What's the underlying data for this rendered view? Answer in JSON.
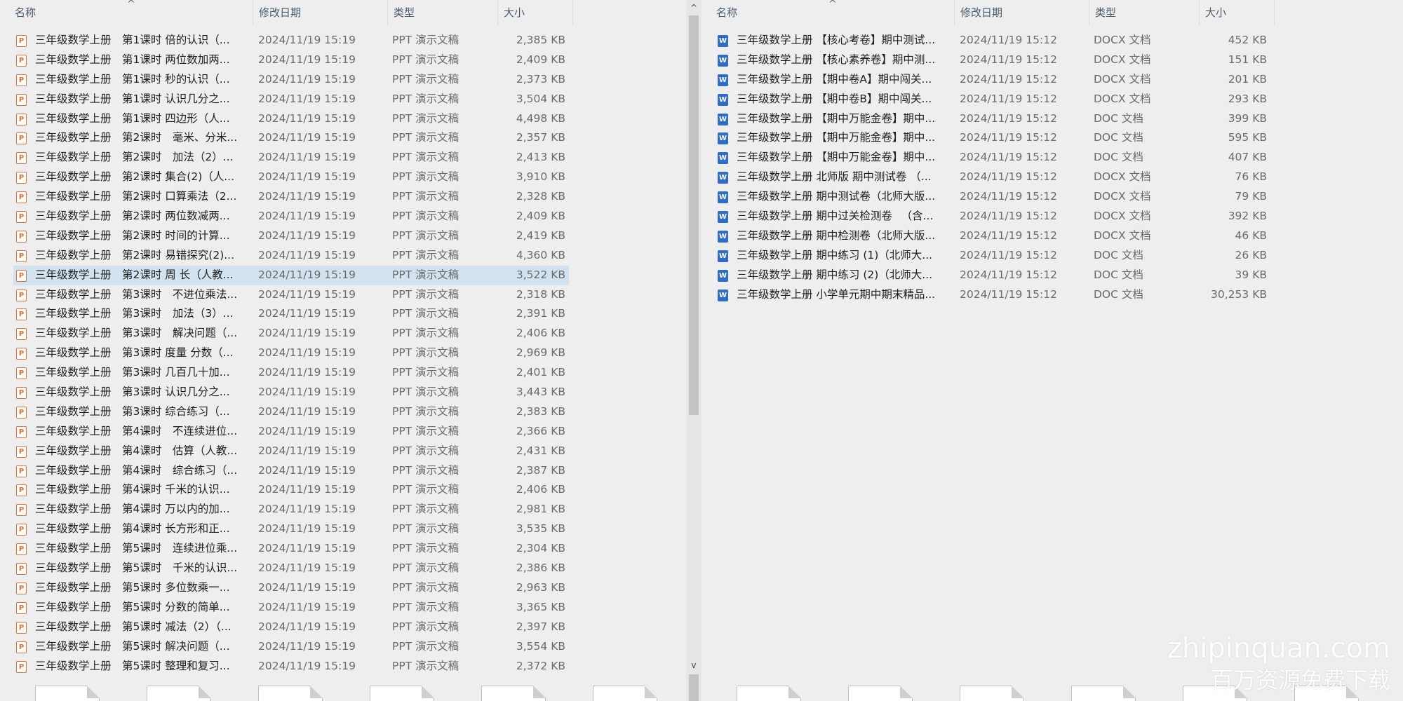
{
  "columns": {
    "name": "名称",
    "date": "修改日期",
    "type": "类型",
    "size": "大小"
  },
  "left_rows": [
    {
      "name": "三年级数学上册　第1课时 倍的认识（...",
      "date": "2024/11/19 15:19",
      "type": "PPT 演示文稿",
      "size": "2,385 KB"
    },
    {
      "name": "三年级数学上册　第1课时 两位数加两...",
      "date": "2024/11/19 15:19",
      "type": "PPT 演示文稿",
      "size": "2,409 KB"
    },
    {
      "name": "三年级数学上册　第1课时 秒的认识（...",
      "date": "2024/11/19 15:19",
      "type": "PPT 演示文稿",
      "size": "2,373 KB"
    },
    {
      "name": "三年级数学上册　第1课时 认识几分之...",
      "date": "2024/11/19 15:19",
      "type": "PPT 演示文稿",
      "size": "3,504 KB"
    },
    {
      "name": "三年级数学上册　第1课时 四边形（人...",
      "date": "2024/11/19 15:19",
      "type": "PPT 演示文稿",
      "size": "4,498 KB"
    },
    {
      "name": "三年级数学上册　第2课时　毫米、分米...",
      "date": "2024/11/19 15:19",
      "type": "PPT 演示文稿",
      "size": "2,357 KB"
    },
    {
      "name": "三年级数学上册　第2课时　加法（2）...",
      "date": "2024/11/19 15:19",
      "type": "PPT 演示文稿",
      "size": "2,413 KB"
    },
    {
      "name": "三年级数学上册　第2课时 集合(2)（人...",
      "date": "2024/11/19 15:19",
      "type": "PPT 演示文稿",
      "size": "3,910 KB"
    },
    {
      "name": "三年级数学上册　第2课时 口算乘法（2...",
      "date": "2024/11/19 15:19",
      "type": "PPT 演示文稿",
      "size": "2,328 KB"
    },
    {
      "name": "三年级数学上册　第2课时 两位数减两...",
      "date": "2024/11/19 15:19",
      "type": "PPT 演示文稿",
      "size": "2,409 KB"
    },
    {
      "name": "三年级数学上册　第2课时 时间的计算...",
      "date": "2024/11/19 15:19",
      "type": "PPT 演示文稿",
      "size": "2,419 KB"
    },
    {
      "name": "三年级数学上册　第2课时 易错探究(2)...",
      "date": "2024/11/19 15:19",
      "type": "PPT 演示文稿",
      "size": "4,360 KB"
    },
    {
      "name": "三年级数学上册　第2课时 周 长（人教...",
      "date": "2024/11/19 15:19",
      "type": "PPT 演示文稿",
      "size": "3,522 KB",
      "selected": true
    },
    {
      "name": "三年级数学上册　第3课时　不进位乘法...",
      "date": "2024/11/19 15:19",
      "type": "PPT 演示文稿",
      "size": "2,318 KB"
    },
    {
      "name": "三年级数学上册　第3课时　加法（3）...",
      "date": "2024/11/19 15:19",
      "type": "PPT 演示文稿",
      "size": "2,391 KB"
    },
    {
      "name": "三年级数学上册　第3课时　解决问题（...",
      "date": "2024/11/19 15:19",
      "type": "PPT 演示文稿",
      "size": "2,406 KB"
    },
    {
      "name": "三年级数学上册　第3课时 度量 分数（...",
      "date": "2024/11/19 15:19",
      "type": "PPT 演示文稿",
      "size": "2,969 KB"
    },
    {
      "name": "三年级数学上册　第3课时 几百几十加...",
      "date": "2024/11/19 15:19",
      "type": "PPT 演示文稿",
      "size": "2,401 KB"
    },
    {
      "name": "三年级数学上册　第3课时 认识几分之...",
      "date": "2024/11/19 15:19",
      "type": "PPT 演示文稿",
      "size": "3,443 KB"
    },
    {
      "name": "三年级数学上册　第3课时 综合练习（...",
      "date": "2024/11/19 15:19",
      "type": "PPT 演示文稿",
      "size": "2,383 KB"
    },
    {
      "name": "三年级数学上册　第4课时　不连续进位...",
      "date": "2024/11/19 15:19",
      "type": "PPT 演示文稿",
      "size": "2,366 KB"
    },
    {
      "name": "三年级数学上册　第4课时　估算（人教...",
      "date": "2024/11/19 15:19",
      "type": "PPT 演示文稿",
      "size": "2,431 KB"
    },
    {
      "name": "三年级数学上册　第4课时　综合练习（...",
      "date": "2024/11/19 15:19",
      "type": "PPT 演示文稿",
      "size": "2,387 KB"
    },
    {
      "name": "三年级数学上册　第4课时 千米的认识...",
      "date": "2024/11/19 15:19",
      "type": "PPT 演示文稿",
      "size": "2,406 KB"
    },
    {
      "name": "三年级数学上册　第4课时 万以内的加...",
      "date": "2024/11/19 15:19",
      "type": "PPT 演示文稿",
      "size": "2,981 KB"
    },
    {
      "name": "三年级数学上册　第4课时 长方形和正...",
      "date": "2024/11/19 15:19",
      "type": "PPT 演示文稿",
      "size": "3,535 KB"
    },
    {
      "name": "三年级数学上册　第5课时　连续进位乘...",
      "date": "2024/11/19 15:19",
      "type": "PPT 演示文稿",
      "size": "2,304 KB"
    },
    {
      "name": "三年级数学上册　第5课时　千米的认识...",
      "date": "2024/11/19 15:19",
      "type": "PPT 演示文稿",
      "size": "2,386 KB"
    },
    {
      "name": "三年级数学上册　第5课时 多位数乘一...",
      "date": "2024/11/19 15:19",
      "type": "PPT 演示文稿",
      "size": "2,963 KB"
    },
    {
      "name": "三年级数学上册　第5课时 分数的简单...",
      "date": "2024/11/19 15:19",
      "type": "PPT 演示文稿",
      "size": "3,365 KB"
    },
    {
      "name": "三年级数学上册　第5课时 减法（2）（...",
      "date": "2024/11/19 15:19",
      "type": "PPT 演示文稿",
      "size": "2,397 KB"
    },
    {
      "name": "三年级数学上册　第5课时 解决问题（...",
      "date": "2024/11/19 15:19",
      "type": "PPT 演示文稿",
      "size": "3,554 KB"
    },
    {
      "name": "三年级数学上册　第5课时 整理和复习...",
      "date": "2024/11/19 15:19",
      "type": "PPT 演示文稿",
      "size": "2,372 KB"
    }
  ],
  "right_rows": [
    {
      "name": "三年级数学上册 【核心考卷】期中测试...",
      "date": "2024/11/19 15:12",
      "type": "DOCX 文档",
      "size": "452 KB"
    },
    {
      "name": "三年级数学上册 【核心素养卷】期中测...",
      "date": "2024/11/19 15:12",
      "type": "DOCX 文档",
      "size": "151 KB"
    },
    {
      "name": "三年级数学上册 【期中卷A】期中闯关...",
      "date": "2024/11/19 15:12",
      "type": "DOCX 文档",
      "size": "201 KB"
    },
    {
      "name": "三年级数学上册 【期中卷B】期中闯关...",
      "date": "2024/11/19 15:12",
      "type": "DOCX 文档",
      "size": "293 KB"
    },
    {
      "name": "三年级数学上册 【期中万能金卷】期中...",
      "date": "2024/11/19 15:12",
      "type": "DOC 文档",
      "size": "399 KB"
    },
    {
      "name": "三年级数学上册 【期中万能金卷】期中...",
      "date": "2024/11/19 15:12",
      "type": "DOC 文档",
      "size": "595 KB"
    },
    {
      "name": "三年级数学上册 【期中万能金卷】期中...",
      "date": "2024/11/19 15:12",
      "type": "DOC 文档",
      "size": "407 KB"
    },
    {
      "name": "三年级数学上册 北师版 期中测试卷 （...",
      "date": "2024/11/19 15:12",
      "type": "DOCX 文档",
      "size": "76 KB"
    },
    {
      "name": "三年级数学上册 期中测试卷（北师大版...",
      "date": "2024/11/19 15:12",
      "type": "DOCX 文档",
      "size": "79 KB"
    },
    {
      "name": "三年级数学上册 期中过关检测卷 　（含...",
      "date": "2024/11/19 15:12",
      "type": "DOCX 文档",
      "size": "392 KB"
    },
    {
      "name": "三年级数学上册 期中检测卷（北师大版...",
      "date": "2024/11/19 15:12",
      "type": "DOCX 文档",
      "size": "46 KB"
    },
    {
      "name": "三年级数学上册 期中练习 (1)（北师大...",
      "date": "2024/11/19 15:12",
      "type": "DOC 文档",
      "size": "26 KB"
    },
    {
      "name": "三年级数学上册 期中练习 (2)（北师大...",
      "date": "2024/11/19 15:12",
      "type": "DOC 文档",
      "size": "39 KB"
    },
    {
      "name": "三年级数学上册 小学单元期中期末精品...",
      "date": "2024/11/19 15:12",
      "type": "DOC 文档",
      "size": "30,253 KB"
    }
  ],
  "icons": {
    "ppt": "ppt-file-icon",
    "word": "word-file-icon",
    "ppt_glyph": "P",
    "word_glyph": "W"
  },
  "scrollbar": {
    "up_glyph": "^",
    "down_glyph": "v"
  },
  "colors": {
    "selection": "#d3e2ef",
    "ppt_icon": "#d9733a",
    "word_icon": "#2f6cc4"
  },
  "watermark": {
    "line1": "zhipinquan.com",
    "line2": "百万资源免费下载"
  }
}
